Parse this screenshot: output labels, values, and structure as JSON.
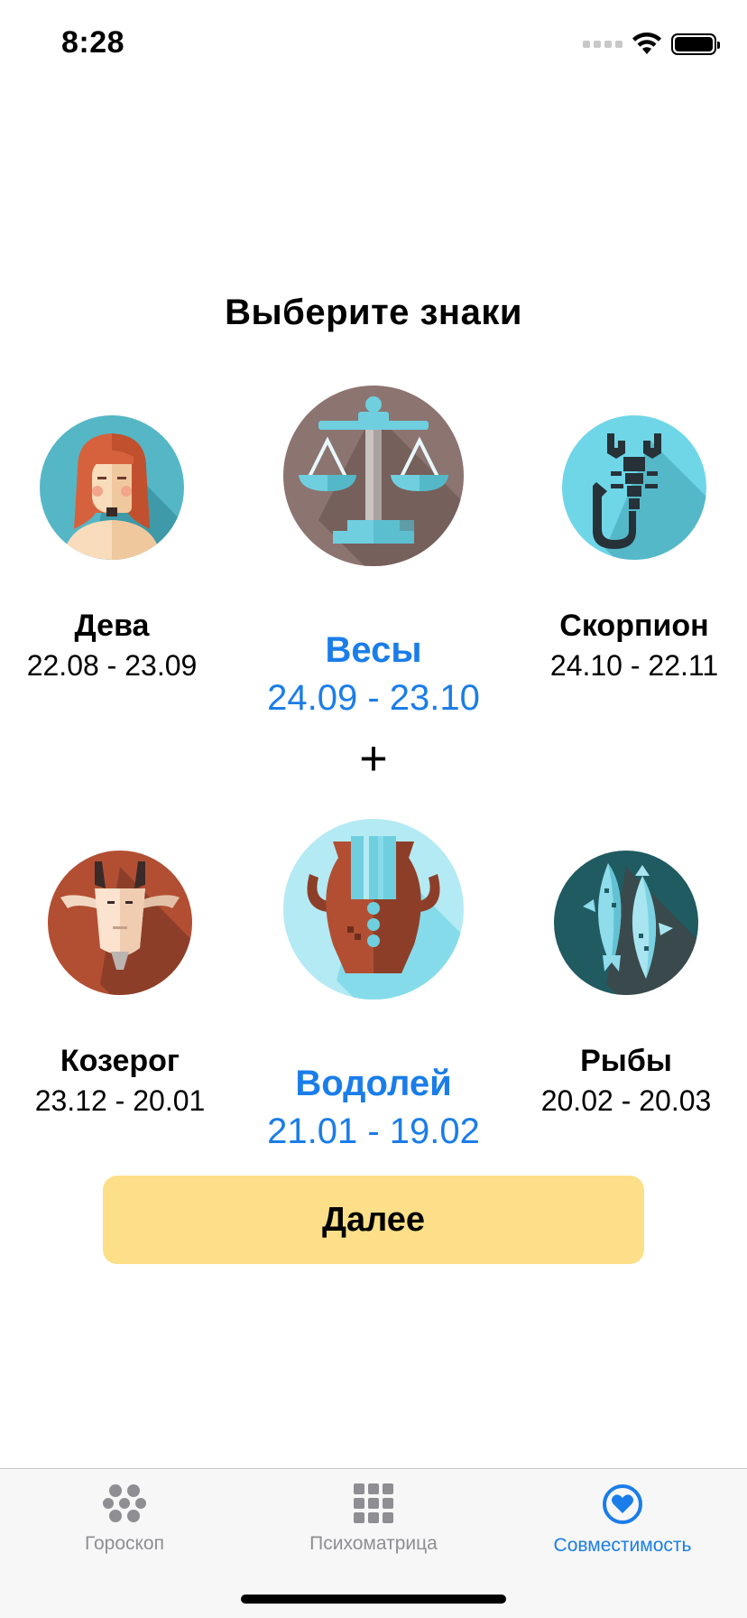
{
  "status": {
    "time": "8:28"
  },
  "title": "Выберите знаки",
  "row1": {
    "left": {
      "name": "Дева",
      "dates": "22.08 - 23.09",
      "icon": "virgo-icon"
    },
    "center": {
      "name": "Весы",
      "dates": "24.09 - 23.10",
      "icon": "libra-icon",
      "selected": true
    },
    "right": {
      "name": "Скорпион",
      "dates": "24.10 - 22.11",
      "icon": "scorpio-icon"
    }
  },
  "plus": "+",
  "row2": {
    "left": {
      "name": "Козерог",
      "dates": "23.12 - 20.01",
      "icon": "capricorn-icon"
    },
    "center": {
      "name": "Водолей",
      "dates": "21.01 - 19.02",
      "icon": "aquarius-icon",
      "selected": true
    },
    "right": {
      "name": "Рыбы",
      "dates": "20.02 - 20.03",
      "icon": "pisces-icon"
    }
  },
  "next_button": "Далее",
  "tabs": [
    {
      "label": "Гороскоп",
      "icon": "horoscope-dots-icon",
      "active": false
    },
    {
      "label": "Психоматрица",
      "icon": "grid-icon",
      "active": false
    },
    {
      "label": "Совместимость",
      "icon": "heart-icon",
      "active": true
    }
  ],
  "colors": {
    "accent": "#1a7de9",
    "button": "#fcdf88",
    "tab_inactive": "#8e8e93"
  }
}
